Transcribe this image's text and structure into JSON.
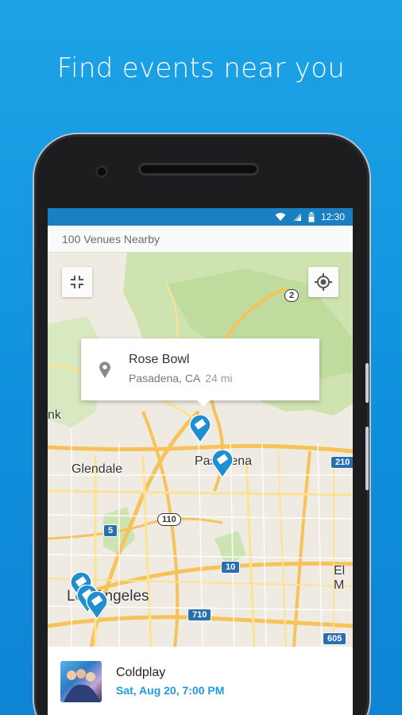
{
  "headline": "Find events near you",
  "status_bar": {
    "time": "12:30",
    "icons": [
      "wifi-icon",
      "signal-icon",
      "battery-icon"
    ]
  },
  "subheader": {
    "label": "100 Venues Nearby"
  },
  "map": {
    "collapse_icon": "collapse-icon",
    "locate_icon": "my-location-icon",
    "labels": {
      "glendale": "Glendale",
      "pasadena": "Pasadena",
      "los_angeles": "Los Angeles",
      "burbank_fragment": "nk",
      "el_monte_fragment": "El M"
    },
    "shields": {
      "r2": "2",
      "r210": "210",
      "r5": "5",
      "r110": "110",
      "r10": "10",
      "r710": "710",
      "r605": "605"
    }
  },
  "popup": {
    "title": "Rose Bowl",
    "location": "Pasadena, CA",
    "distance": "24 mi"
  },
  "event": {
    "title": "Coldplay",
    "date": "Sat, Aug 20, 7:00 PM"
  },
  "colors": {
    "accent": "#1e9be0",
    "status_bar": "#1a7fc1",
    "pin": "#1f8fd0"
  }
}
